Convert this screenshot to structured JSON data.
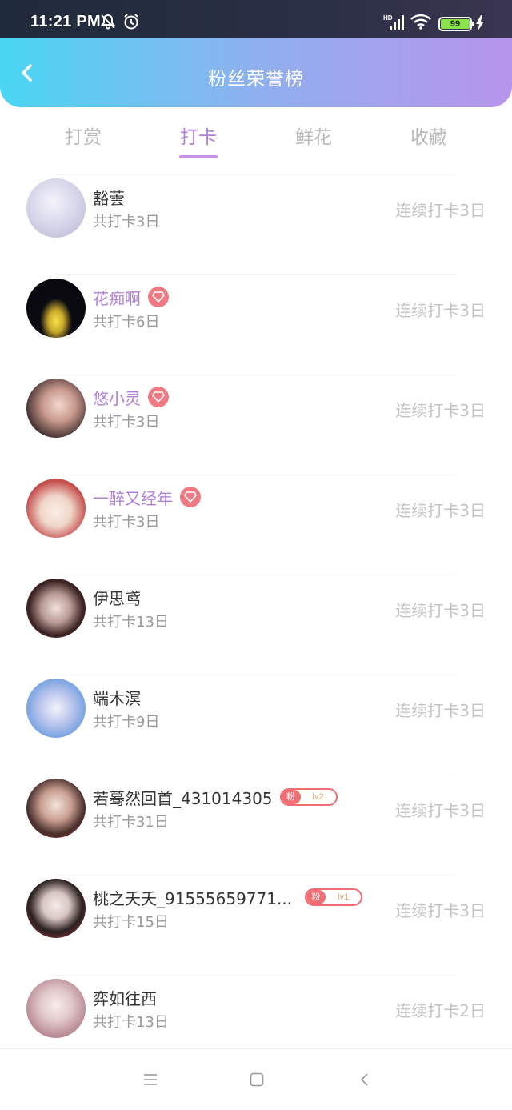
{
  "status_bar": {
    "time": "11:21 PM",
    "battery": "99",
    "icons": [
      "bell-off-icon",
      "alarm-icon",
      "signal-icon",
      "wifi-icon",
      "battery-icon",
      "charging-icon"
    ]
  },
  "header": {
    "title": "粉丝荣誉榜",
    "back_icon": "chevron-left-icon",
    "gradient": [
      "#49d6f3",
      "#b794ec"
    ]
  },
  "tabs": [
    {
      "label": "打赏",
      "active": false
    },
    {
      "label": "打卡",
      "active": true
    },
    {
      "label": "鲜花",
      "active": false
    },
    {
      "label": "收藏",
      "active": false
    }
  ],
  "accent_color": "#b07fd9",
  "fans": [
    {
      "name": "豁蕓",
      "total": "共打卡3日",
      "streak": "连续打卡3日",
      "vip": false,
      "badge": null
    },
    {
      "name": "花痴啊",
      "total": "共打卡6日",
      "streak": "连续打卡3日",
      "vip": true,
      "badge": "gem-icon"
    },
    {
      "name": "悠小灵",
      "total": "共打卡3日",
      "streak": "连续打卡3日",
      "vip": true,
      "badge": "gem-icon"
    },
    {
      "name": "一醉又经年",
      "total": "共打卡3日",
      "streak": "连续打卡3日",
      "vip": true,
      "badge": "gem-icon"
    },
    {
      "name": "伊思鸢",
      "total": "共打卡13日",
      "streak": "连续打卡3日",
      "vip": false,
      "badge": null
    },
    {
      "name": "端木溟",
      "total": "共打卡9日",
      "streak": "连续打卡3日",
      "vip": false,
      "badge": null
    },
    {
      "name": "若蓦然回首_431014305",
      "total": "共打卡31日",
      "streak": "连续打卡3日",
      "vip": false,
      "badge": {
        "fan": "粉",
        "level": "lv2"
      }
    },
    {
      "name": "桃之夭夭_91555659771...",
      "total": "共打卡15日",
      "streak": "连续打卡3日",
      "vip": false,
      "badge": {
        "fan": "粉",
        "level": "lv1"
      }
    },
    {
      "name": "弈如往西",
      "total": "共打卡13日",
      "streak": "连续打卡2日",
      "vip": false,
      "badge": null
    }
  ],
  "nav_bar": {
    "buttons": [
      "menu-icon",
      "home-square-icon",
      "back-triangle-icon"
    ]
  }
}
